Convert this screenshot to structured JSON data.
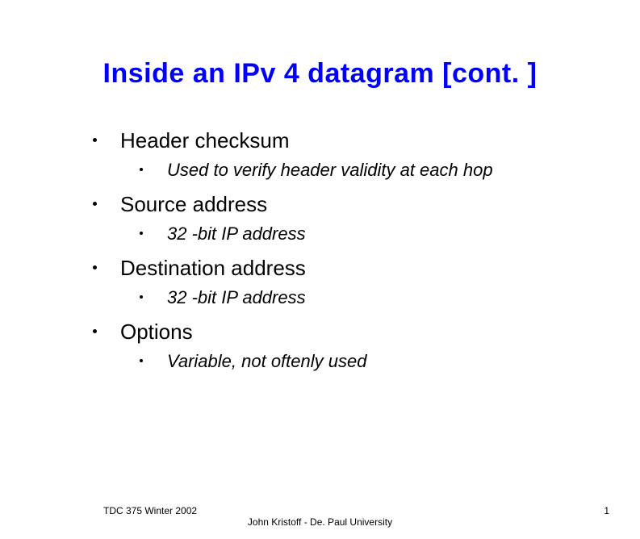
{
  "title": "Inside an IPv 4 datagram [cont. ]",
  "items": [
    {
      "label": "Header checksum",
      "sub": "Used to verify header validity at each hop"
    },
    {
      "label": "Source address",
      "sub": "32 -bit IP address"
    },
    {
      "label": "Destination address",
      "sub": "32 -bit IP address"
    },
    {
      "label": "Options",
      "sub": "Variable, not oftenly used"
    }
  ],
  "footer": {
    "left": "TDC 375 Winter 2002",
    "center": "John Kristoff - De. Paul University",
    "right": "1"
  }
}
